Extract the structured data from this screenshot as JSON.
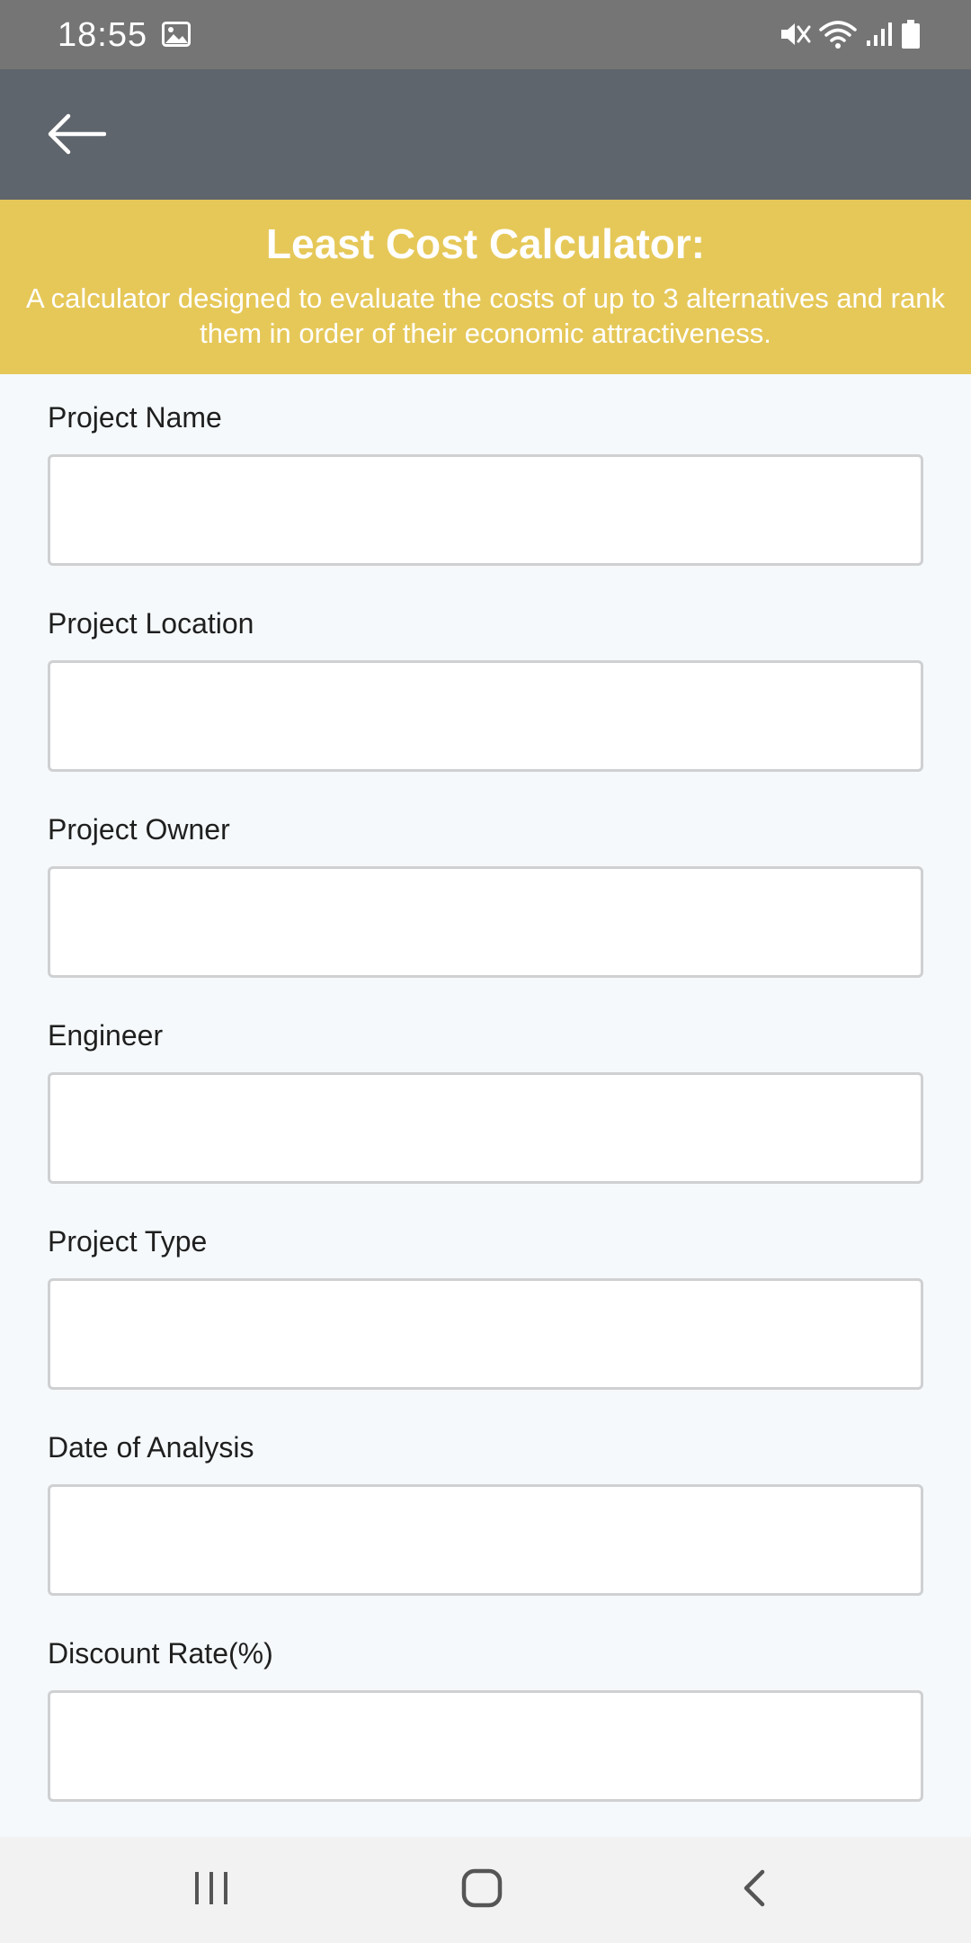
{
  "status_bar": {
    "time": "18:55",
    "left_icons": [
      "image-icon"
    ],
    "right_icons": [
      "mute-icon",
      "wifi-icon",
      "signal-icon",
      "battery-icon"
    ]
  },
  "app_bar": {
    "back_icon": "arrow-left-icon"
  },
  "banner": {
    "title": "Least Cost Calculator:",
    "description": "A calculator designed to evaluate the costs of up to 3 alternatives and rank them in order of their economic attractiveness."
  },
  "form": {
    "fields": [
      {
        "label": "Project Name",
        "value": ""
      },
      {
        "label": "Project Location",
        "value": ""
      },
      {
        "label": "Project Owner",
        "value": ""
      },
      {
        "label": "Engineer",
        "value": ""
      },
      {
        "label": "Project Type",
        "value": ""
      },
      {
        "label": "Date of Analysis",
        "value": ""
      },
      {
        "label": "Discount Rate(%)",
        "value": ""
      }
    ]
  },
  "nav_bar": {
    "buttons": [
      "recent-apps-icon",
      "home-icon",
      "back-icon"
    ]
  },
  "colors": {
    "status_bar": "#757575",
    "app_bar": "#5f656c",
    "banner": "#e6c859",
    "background": "#f5f9fb",
    "input_border": "#cfd0d2"
  }
}
